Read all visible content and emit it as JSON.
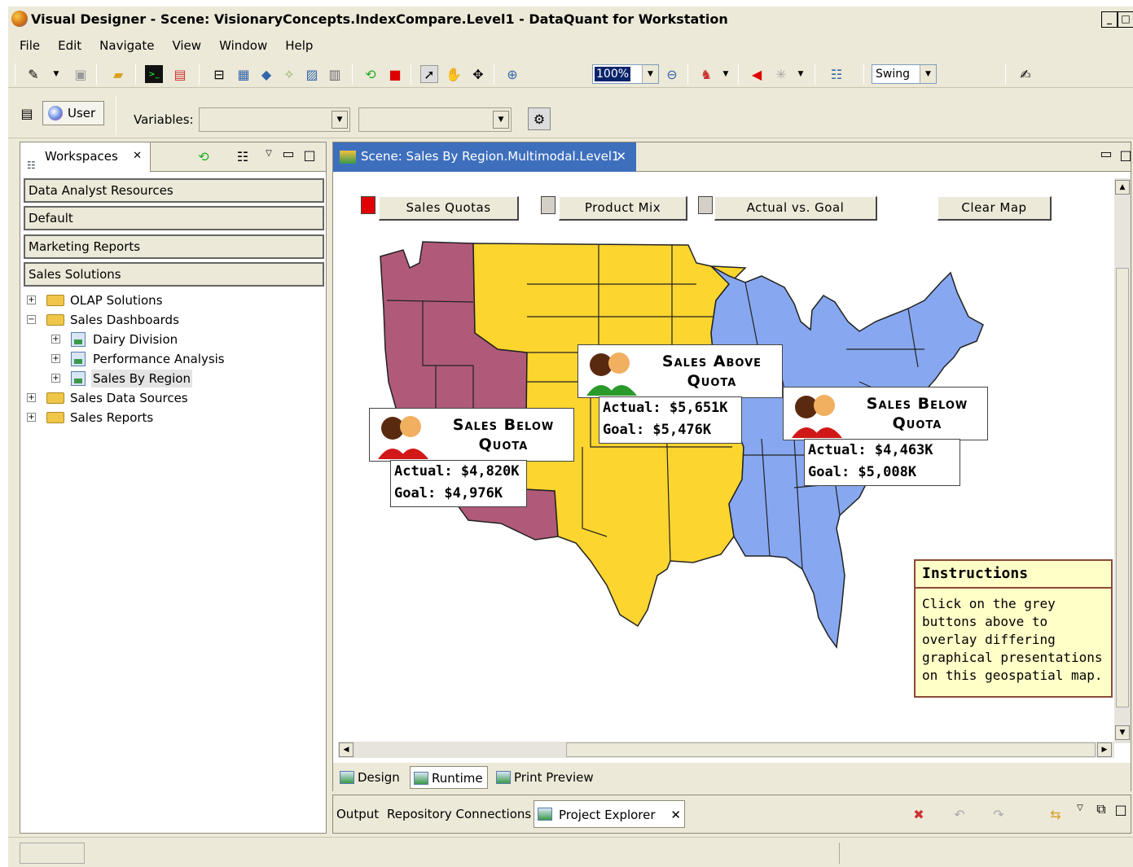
{
  "window": {
    "title": "Visual Designer - Scene: VisionaryConcepts.IndexCompare.Level1 - DataQuant for Workstation"
  },
  "menu": [
    "File",
    "Edit",
    "Navigate",
    "View",
    "Window",
    "Help"
  ],
  "toolbar": {
    "zoom": "100%",
    "renderer": "Swing"
  },
  "varbar": {
    "user_label": "User",
    "variables_label": "Variables:"
  },
  "left_panel": {
    "tab_label": "Workspaces",
    "sections": [
      "Data Analyst Resources",
      "Default",
      "Marketing Reports",
      "Sales Solutions"
    ],
    "tree": [
      {
        "label": "OLAP Solutions",
        "expander": "+"
      },
      {
        "label": "Sales Dashboards",
        "expander": "−"
      },
      {
        "label": "Dairy Division",
        "expander": "+"
      },
      {
        "label": "Performance Analysis",
        "expander": "+"
      },
      {
        "label": "Sales By Region",
        "expander": "+"
      },
      {
        "label": "Sales Data Sources",
        "expander": "+"
      },
      {
        "label": "Sales Reports",
        "expander": "+"
      }
    ]
  },
  "editor": {
    "tab_label": "Scene: Sales By Region.Multimodal.Level1",
    "buttons": {
      "sales_quotas": "Sales Quotas",
      "product_mix": "Product Mix",
      "actual_vs_goal": "Actual vs. Goal",
      "clear_map": "Clear Map"
    },
    "callouts": {
      "west": {
        "title_line1": "Sales Below",
        "title_line2": "Quota",
        "actual": "Actual:  $4,820K",
        "goal": "Goal:   $4,976K"
      },
      "central": {
        "title_line1": "Sales Above",
        "title_line2": "Quota",
        "actual": "Actual:  $5,651K",
        "goal": "Goal:   $5,476K"
      },
      "east": {
        "title_line1": "Sales Below",
        "title_line2": "Quota",
        "actual": "Actual:  $4,463K",
        "goal": "Goal:   $5,008K"
      }
    },
    "instructions": {
      "title": "Instructions",
      "body": "Click on the grey buttons above to overlay differing graphical presentations on this geospatial map."
    },
    "bottom_tabs": [
      "Design",
      "Runtime",
      "Print Preview"
    ],
    "colors": {
      "west_region": "#b05a7a",
      "central_region": "#fcd52f",
      "east_region": "#87a8f0",
      "sales_quotas_indicator": "#e00000"
    }
  },
  "bottom_views": {
    "tabs": [
      "Output",
      "Repository Connections",
      "Project Explorer"
    ]
  }
}
